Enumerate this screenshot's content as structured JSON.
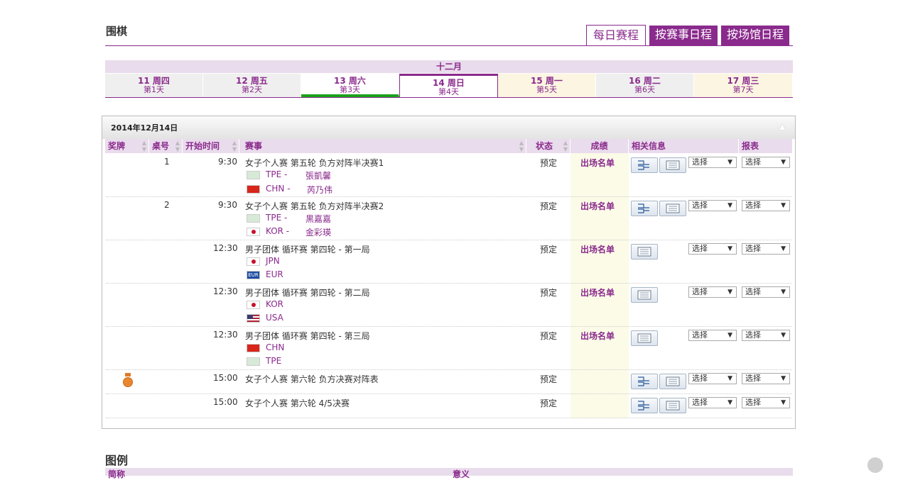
{
  "header": {
    "title": "围棋",
    "tabs": [
      {
        "label": "每日赛程",
        "active": true
      },
      {
        "label": "按赛事日程",
        "active": false
      },
      {
        "label": "按场馆日程",
        "active": false
      }
    ]
  },
  "calendar": {
    "month": "十二月",
    "days": [
      {
        "date": "11 周四",
        "day": "第1天"
      },
      {
        "date": "12 周五",
        "day": "第2天"
      },
      {
        "date": "13 周六",
        "day": "第3天"
      },
      {
        "date": "14 周日",
        "day": "第4天"
      },
      {
        "date": "15 周一",
        "day": "第5天"
      },
      {
        "date": "16 周二",
        "day": "第6天"
      },
      {
        "date": "17 周三",
        "day": "第7天"
      }
    ],
    "selected_index": 3
  },
  "schedule": {
    "date": "2014年12月14日",
    "columns": {
      "medal": "奖牌",
      "table": "桌号",
      "start": "开始时间",
      "event": "赛事",
      "status": "状态",
      "result": "成绩",
      "info": "相关信息",
      "report": "报表"
    },
    "select_label": "选择",
    "rows": [
      {
        "table": "1",
        "time": "9:30",
        "event": "女子个人赛 第五轮 负方对阵半决赛1",
        "status": "预定",
        "result": "出场名单",
        "teams": [
          {
            "code": "TPE -",
            "name": "張凱馨",
            "flag": "TPE"
          },
          {
            "code": "CHN -",
            "name": "芮乃伟",
            "flag": "CHN"
          }
        ],
        "bracket": true
      },
      {
        "table": "2",
        "time": "9:30",
        "event": "女子个人赛 第五轮 负方对阵半决赛2",
        "status": "预定",
        "result": "出场名单",
        "teams": [
          {
            "code": "TPE -",
            "name": "黒嘉嘉",
            "flag": "TPE"
          },
          {
            "code": "KOR -",
            "name": "金彩瑛",
            "flag": "KOR"
          }
        ],
        "bracket": true
      },
      {
        "table": "",
        "time": "12:30",
        "event": "男子团体 循环赛 第四轮 - 第一局",
        "status": "预定",
        "result": "出场名单",
        "teams": [
          {
            "code": "JPN",
            "name": "",
            "flag": "JPN"
          },
          {
            "code": "EUR",
            "name": "",
            "flag": "EUR"
          }
        ],
        "bracket": false
      },
      {
        "table": "",
        "time": "12:30",
        "event": "男子团体 循环赛 第四轮 - 第二局",
        "status": "预定",
        "result": "出场名单",
        "teams": [
          {
            "code": "KOR",
            "name": "",
            "flag": "KOR"
          },
          {
            "code": "USA",
            "name": "",
            "flag": "USA"
          }
        ],
        "bracket": false
      },
      {
        "table": "",
        "time": "12:30",
        "event": "男子团体 循环赛 第四轮 - 第三局",
        "status": "预定",
        "result": "出场名单",
        "teams": [
          {
            "code": "CHN",
            "name": "",
            "flag": "CHN"
          },
          {
            "code": "TPE",
            "name": "",
            "flag": "TPE"
          }
        ],
        "bracket": false
      },
      {
        "table": "",
        "time": "15:00",
        "event": "女子个人赛 第六轮 负方决赛对阵表",
        "status": "预定",
        "result": "",
        "teams": [],
        "bracket": true,
        "medal": "bronze"
      },
      {
        "table": "",
        "time": "15:00",
        "event": "女子个人赛 第六轮 4/5决赛",
        "status": "预定",
        "result": "",
        "teams": [],
        "bracket": true
      }
    ]
  },
  "legend": {
    "title": "图例",
    "col_abbr": "简称",
    "col_meaning": "意义"
  },
  "colors": {
    "accent": "#8a2a8c",
    "tab_band": "#e9dcec",
    "score_bg": "#fbfbe8",
    "green": "#1aa31a"
  }
}
